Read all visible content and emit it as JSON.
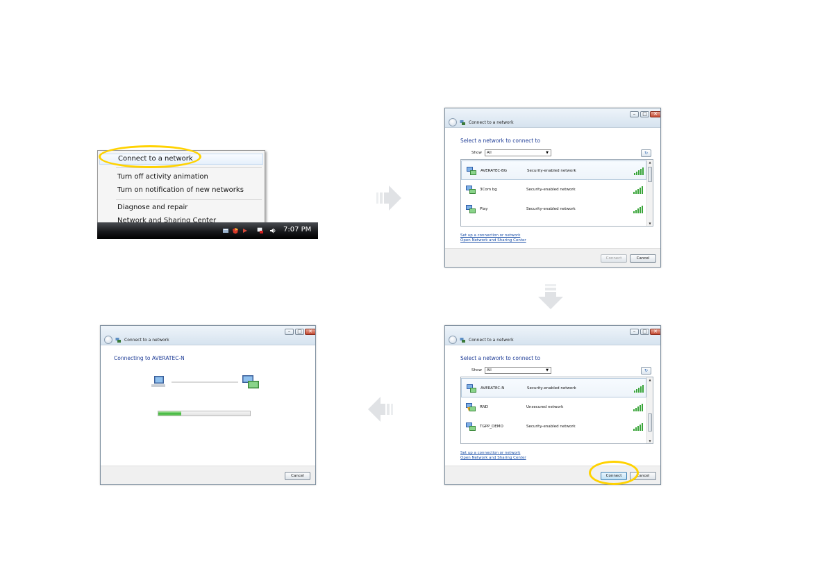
{
  "tray_menu": {
    "items": [
      "Connect to a network",
      "Turn off activity animation",
      "Turn on notification of new networks",
      "Diagnose and repair",
      "Network and Sharing Center"
    ],
    "clock": "7:07 PM"
  },
  "dialog": {
    "title": "Connect to a network",
    "heading": "Select a network to connect to",
    "show_label": "Show",
    "show_value": "All",
    "links": [
      "Set up a connection or network",
      "Open Network and Sharing Center"
    ],
    "connect_label": "Connect",
    "cancel_label": "Cancel"
  },
  "list_before": [
    {
      "name": "AVERATEC-BG",
      "security": "Security-enabled network"
    },
    {
      "name": "3Com bg",
      "security": "Security-enabled network"
    },
    {
      "name": "Play",
      "security": "Security-enabled network"
    }
  ],
  "list_after": [
    {
      "name": "AVERATEC-N",
      "security": "Security-enabled network"
    },
    {
      "name": "RND",
      "security": "Unsecured network"
    },
    {
      "name": "TGPP_DEMO",
      "security": "Security-enabled network"
    }
  ],
  "connecting": {
    "title": "Connect to a network",
    "heading": "Connecting to AVERATEC-N",
    "progress": 0.25,
    "cancel_label": "Cancel"
  },
  "colors": {
    "highlight_ring": "#ffd200",
    "link": "#1a4fa8",
    "heading": "#1e3c96",
    "signal": "#3aa53a",
    "arrow": "#e3e5e8"
  }
}
